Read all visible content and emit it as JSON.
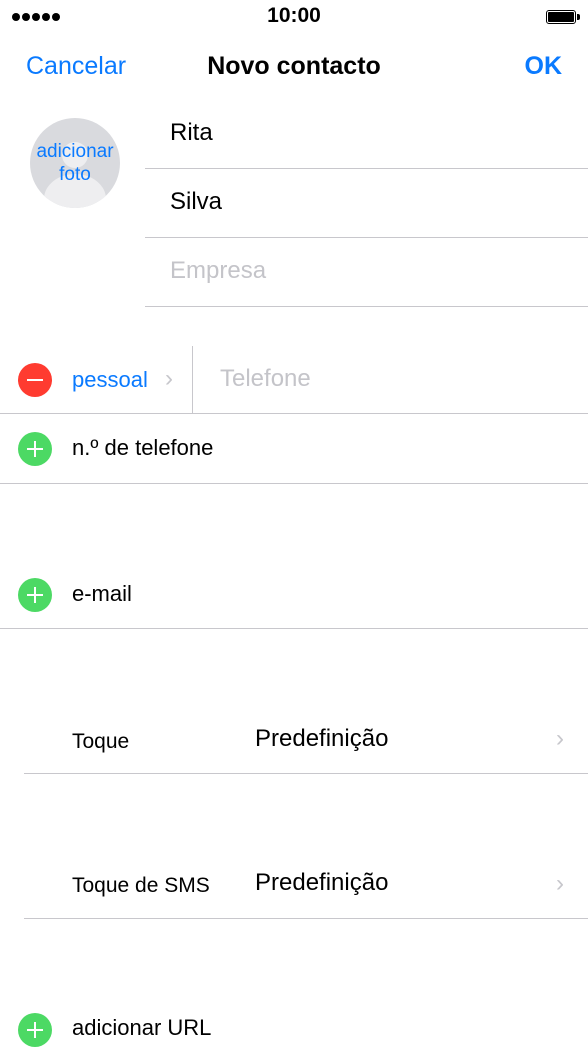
{
  "status_bar": {
    "time": "10:00"
  },
  "nav": {
    "cancel": "Cancelar",
    "title": "Novo contacto",
    "ok": "OK"
  },
  "photo": {
    "label": "adicionar\nfoto"
  },
  "name_fields": {
    "first": "Rita",
    "last": "Silva",
    "company_placeholder": "Empresa"
  },
  "phone": {
    "type_label": "pessoal",
    "placeholder": "Telefone",
    "add_label": "n.º de telefone"
  },
  "email": {
    "add_label": "e-mail"
  },
  "ringtone": {
    "label": "Toque",
    "value": "Predefinição"
  },
  "sms_tone": {
    "label": "Toque de SMS",
    "value": "Predefinição"
  },
  "url": {
    "add_label": "adicionar URL"
  },
  "colors": {
    "accent": "#0a7aff",
    "delete": "#ff3b30",
    "add": "#4cd964",
    "separator": "#c8c7cc",
    "placeholder": "#c4c4c9"
  }
}
